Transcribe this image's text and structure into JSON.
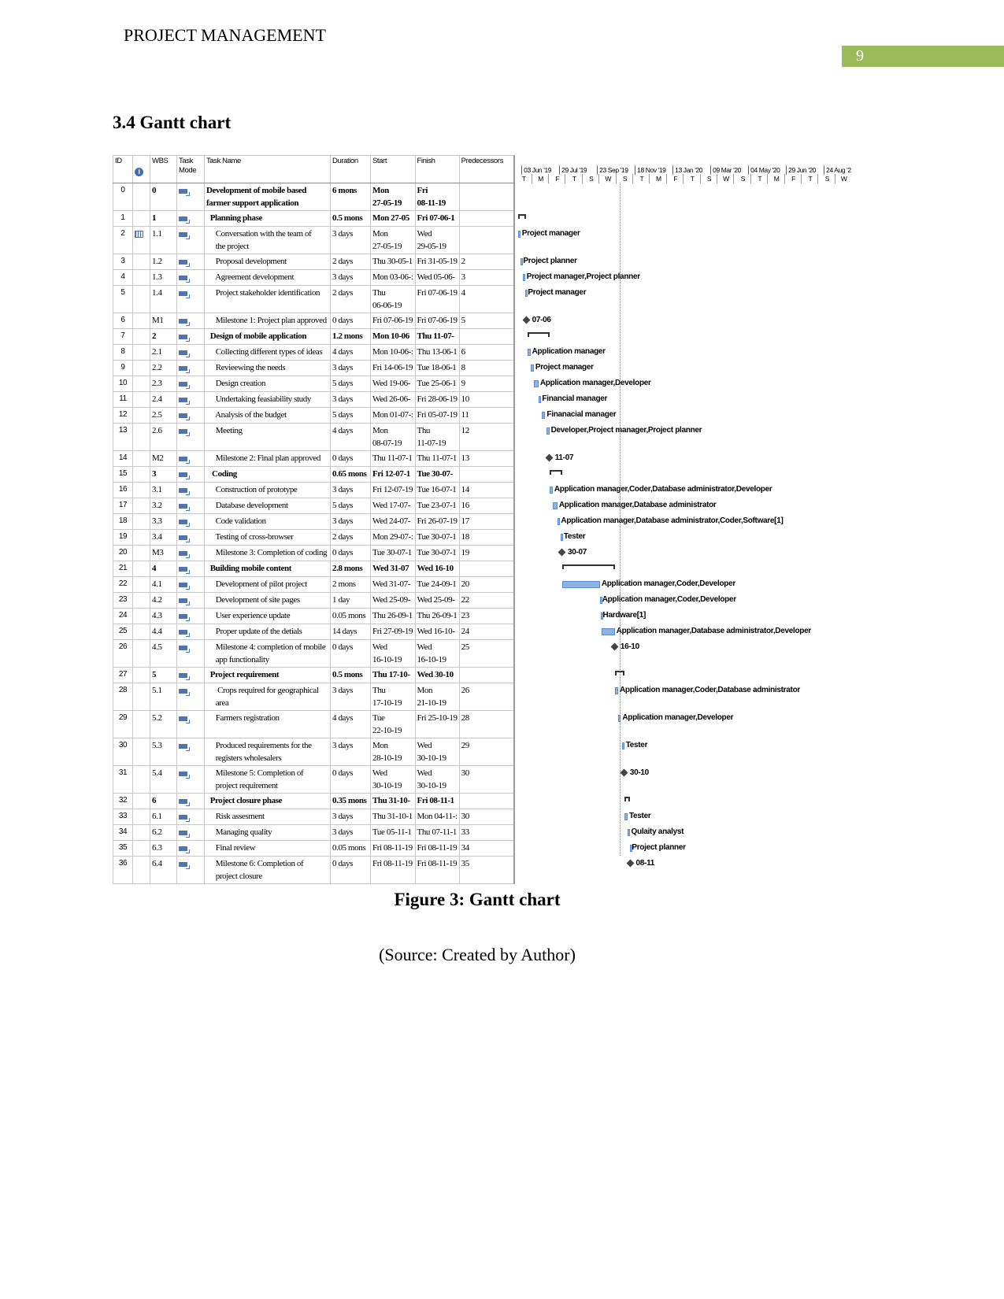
{
  "header": {
    "running_head": "PROJECT MANAGEMENT",
    "page_number": "9",
    "accent": "#9bbb59"
  },
  "section_title": "3.4 Gantt chart",
  "figure": {
    "caption": "Figure 3: Gantt chart",
    "source": "(Source: Created by Author)"
  },
  "chart_data": {
    "type": "gantt",
    "columns": [
      "ID",
      "",
      "WBS",
      "Task\nMode",
      "Task Name",
      "Duration",
      "Start",
      "Finish",
      "Predecessors"
    ],
    "timescale": [
      "03 Jun '19",
      "29 Jul '19",
      "23 Sep '19",
      "18 Nov '19",
      "13 Jan '20",
      "09 Mar '20",
      "04 May '20",
      "29 Jun '20",
      "24 Aug '2"
    ],
    "timescale_days": [
      "T",
      "M",
      "F",
      "T",
      "S",
      "W",
      "S",
      "T",
      "M",
      "F",
      "T",
      "S",
      "W",
      "S",
      "T",
      "M",
      "F",
      "T",
      "S",
      "W"
    ],
    "bar_color": "#8db3e2",
    "tasks": [
      {
        "id": "0",
        "wbs": "0",
        "name": "Development of mobile based\nfarmer support application",
        "duration": "6 mons",
        "start": "Mon\n27-05-19",
        "finish": "Fri\n08-11-19",
        "pred": "",
        "kind": "project",
        "from": "2019-05-27",
        "to": "2019-11-08",
        "resources": ""
      },
      {
        "id": "1",
        "wbs": "1",
        "name": "  Planning phase",
        "duration": "0.5 mons",
        "start": "Mon 27-05",
        "finish": "Fri 07-06-1",
        "pred": "",
        "kind": "summary",
        "from": "2019-05-27",
        "to": "2019-06-07",
        "resources": ""
      },
      {
        "id": "2",
        "wbs": "1.1",
        "name": "     Conversation with the team of\n     the project",
        "duration": "3 days",
        "start": "Mon\n27-05-19",
        "finish": "Wed\n29-05-19",
        "pred": "",
        "kind": "task",
        "from": "2019-05-27",
        "to": "2019-05-29",
        "resources": "Project manager",
        "note": true
      },
      {
        "id": "3",
        "wbs": "1.2",
        "name": "     Proposal development",
        "duration": "2 days",
        "start": "Thu 30-05-1",
        "finish": "Fri 31-05-19",
        "pred": "2",
        "kind": "task",
        "from": "2019-05-30",
        "to": "2019-05-31",
        "resources": "Project planner"
      },
      {
        "id": "4",
        "wbs": "1.3",
        "name": "     Agreement development",
        "duration": "3 days",
        "start": "Mon 03-06-:",
        "finish": "Wed 05-06-",
        "pred": "3",
        "kind": "task",
        "from": "2019-06-03",
        "to": "2019-06-05",
        "resources": "Project manager,Project planner"
      },
      {
        "id": "5",
        "wbs": "1.4",
        "name": "     Project stakeholder identification",
        "duration": "2 days",
        "start": "Thu\n06-06-19",
        "finish": "Fri 07-06-19",
        "pred": "4",
        "kind": "task",
        "from": "2019-06-06",
        "to": "2019-06-07",
        "resources": "Project manager"
      },
      {
        "id": "6",
        "wbs": "M1",
        "name": "     Milestone 1: Project plan approved",
        "duration": "0 days",
        "start": "Fri 07-06-19",
        "finish": "Fri 07-06-19",
        "pred": "5",
        "kind": "milestone",
        "from": "2019-06-07",
        "to": "2019-06-07",
        "resources": "07-06"
      },
      {
        "id": "7",
        "wbs": "2",
        "name": "  Design of mobile application",
        "duration": "1.2 mons",
        "start": "Mon 10-06",
        "finish": "Thu 11-07-",
        "pred": "",
        "kind": "summary",
        "from": "2019-06-10",
        "to": "2019-07-11",
        "resources": ""
      },
      {
        "id": "8",
        "wbs": "2.1",
        "name": "     Collecting different types of ideas",
        "duration": "4 days",
        "start": "Mon 10-06-:",
        "finish": "Thu 13-06-1",
        "pred": "6",
        "kind": "task",
        "from": "2019-06-10",
        "to": "2019-06-13",
        "resources": "Application manager"
      },
      {
        "id": "9",
        "wbs": "2.2",
        "name": "     Revieewing the needs",
        "duration": "3 days",
        "start": "Fri 14-06-19",
        "finish": "Tue 18-06-1",
        "pred": "8",
        "kind": "task",
        "from": "2019-06-14",
        "to": "2019-06-18",
        "resources": "Project manager"
      },
      {
        "id": "10",
        "wbs": "2.3",
        "name": "     Design creation",
        "duration": "5 days",
        "start": "Wed 19-06-",
        "finish": "Tue 25-06-1",
        "pred": "9",
        "kind": "task",
        "from": "2019-06-19",
        "to": "2019-06-25",
        "resources": "Application manager,Developer"
      },
      {
        "id": "11",
        "wbs": "2.4",
        "name": "     Undertaking feasiability study",
        "duration": "3 days",
        "start": "Wed 26-06-",
        "finish": "Fri 28-06-19",
        "pred": "10",
        "kind": "task",
        "from": "2019-06-26",
        "to": "2019-06-28",
        "resources": "Financial manager"
      },
      {
        "id": "12",
        "wbs": "2.5",
        "name": "     Analysis of the budget",
        "duration": "5 days",
        "start": "Mon 01-07-:",
        "finish": "Fri 05-07-19",
        "pred": "11",
        "kind": "task",
        "from": "2019-07-01",
        "to": "2019-07-05",
        "resources": "Finanacial manager"
      },
      {
        "id": "13",
        "wbs": "2.6",
        "name": "     Meeting",
        "duration": "4 days",
        "start": "Mon\n08-07-19",
        "finish": "Thu\n11-07-19",
        "pred": "12",
        "kind": "task",
        "from": "2019-07-08",
        "to": "2019-07-11",
        "resources": "Developer,Project manager,Project planner"
      },
      {
        "id": "14",
        "wbs": "M2",
        "name": "     Milestone 2: Final plan approved",
        "duration": "0 days",
        "start": "Thu 11-07-1",
        "finish": "Thu 11-07-1",
        "pred": "13",
        "kind": "milestone",
        "from": "2019-07-11",
        "to": "2019-07-11",
        "resources": "11-07"
      },
      {
        "id": "15",
        "wbs": "3",
        "name": "   Coding",
        "duration": "0.65 mons",
        "start": "Fri 12-07-1",
        "finish": "Tue 30-07-",
        "pred": "",
        "kind": "summary",
        "from": "2019-07-12",
        "to": "2019-07-30",
        "resources": ""
      },
      {
        "id": "16",
        "wbs": "3.1",
        "name": "     Construction of prototype",
        "duration": "3 days",
        "start": "Fri 12-07-19",
        "finish": "Tue 16-07-1",
        "pred": "14",
        "kind": "task",
        "from": "2019-07-12",
        "to": "2019-07-16",
        "resources": "Application manager,Coder,Database administrator,Developer"
      },
      {
        "id": "17",
        "wbs": "3.2",
        "name": "     Database development",
        "duration": "5 days",
        "start": "Wed 17-07-",
        "finish": "Tue 23-07-1",
        "pred": "16",
        "kind": "task",
        "from": "2019-07-17",
        "to": "2019-07-23",
        "resources": "Application manager,Database administrator"
      },
      {
        "id": "18",
        "wbs": "3.3",
        "name": "     Code validation",
        "duration": "3 days",
        "start": "Wed 24-07-",
        "finish": "Fri 26-07-19",
        "pred": "17",
        "kind": "task",
        "from": "2019-07-24",
        "to": "2019-07-26",
        "resources": "Application manager,Database administrator,Coder,Software[1]"
      },
      {
        "id": "19",
        "wbs": "3.4",
        "name": "     Testing of cross-browser",
        "duration": "2 days",
        "start": "Mon 29-07-:",
        "finish": "Tue 30-07-1",
        "pred": "18",
        "kind": "task",
        "from": "2019-07-29",
        "to": "2019-07-30",
        "resources": "Tester"
      },
      {
        "id": "20",
        "wbs": "M3",
        "name": "     Milestone 3: Completion of coding",
        "duration": "0 days",
        "start": "Tue 30-07-1",
        "finish": "Tue 30-07-1",
        "pred": "19",
        "kind": "milestone",
        "from": "2019-07-30",
        "to": "2019-07-30",
        "resources": "30-07"
      },
      {
        "id": "21",
        "wbs": "4",
        "name": "  Building mobile content",
        "duration": "2.8 mons",
        "start": "Wed 31-07",
        "finish": "Wed 16-10",
        "pred": "",
        "kind": "summary",
        "from": "2019-07-31",
        "to": "2019-10-16",
        "resources": ""
      },
      {
        "id": "22",
        "wbs": "4.1",
        "name": "     Development of pilot project",
        "duration": "2 mons",
        "start": "Wed 31-07-",
        "finish": "Tue 24-09-1",
        "pred": "20",
        "kind": "task",
        "from": "2019-07-31",
        "to": "2019-09-24",
        "resources": "Application manager,Coder,Developer"
      },
      {
        "id": "23",
        "wbs": "4.2",
        "name": "     Development of site pages",
        "duration": "1 day",
        "start": "Wed 25-09-",
        "finish": "Wed 25-09-",
        "pred": "22",
        "kind": "task",
        "from": "2019-09-25",
        "to": "2019-09-25",
        "resources": "Application manager,Coder,Developer"
      },
      {
        "id": "24",
        "wbs": "4.3",
        "name": "     User experience update",
        "duration": "0.05 mons",
        "start": "Thu 26-09-1",
        "finish": "Thu 26-09-1",
        "pred": "23",
        "kind": "task",
        "from": "2019-09-26",
        "to": "2019-09-26",
        "resources": "Hardware[1]"
      },
      {
        "id": "25",
        "wbs": "4.4",
        "name": "     Proper update of the detials",
        "duration": "14 days",
        "start": "Fri 27-09-19",
        "finish": "Wed 16-10-",
        "pred": "24",
        "kind": "task",
        "from": "2019-09-27",
        "to": "2019-10-16",
        "resources": "Application manager,Database administrator,Developer"
      },
      {
        "id": "26",
        "wbs": "4.5",
        "name": "     Milestone 4: completion of mobile\n     app functionality",
        "duration": "0 days",
        "start": "Wed\n16-10-19",
        "finish": "Wed\n16-10-19",
        "pred": "25",
        "kind": "milestone",
        "from": "2019-10-16",
        "to": "2019-10-16",
        "resources": "16-10"
      },
      {
        "id": "27",
        "wbs": "5",
        "name": "  Project requirement",
        "duration": "0.5 mons",
        "start": "Thu 17-10-",
        "finish": "Wed 30-10",
        "pred": "",
        "kind": "summary",
        "from": "2019-10-17",
        "to": "2019-10-30",
        "resources": ""
      },
      {
        "id": "28",
        "wbs": "5.1",
        "name": "      Crops required for geographical\n     area",
        "duration": "3 days",
        "start": "Thu\n17-10-19",
        "finish": "Mon\n21-10-19",
        "pred": "26",
        "kind": "task",
        "from": "2019-10-17",
        "to": "2019-10-21",
        "resources": "Application manager,Coder,Database administrator"
      },
      {
        "id": "29",
        "wbs": "5.2",
        "name": "     Farmers registration",
        "duration": "4 days",
        "start": "Tue\n22-10-19",
        "finish": "Fri 25-10-19",
        "pred": "28",
        "kind": "task",
        "from": "2019-10-22",
        "to": "2019-10-25",
        "resources": "Application manager,Developer"
      },
      {
        "id": "30",
        "wbs": "5.3",
        "name": "     Produced requirements for the\n     registers wholesalers",
        "duration": "3 days",
        "start": "Mon\n28-10-19",
        "finish": "Wed\n30-10-19",
        "pred": "29",
        "kind": "task",
        "from": "2019-10-28",
        "to": "2019-10-30",
        "resources": "Tester"
      },
      {
        "id": "31",
        "wbs": "5.4",
        "name": "     Milestone 5: Completion of\n     project requirement",
        "duration": "0 days",
        "start": "Wed\n30-10-19",
        "finish": "Wed\n30-10-19",
        "pred": "30",
        "kind": "milestone",
        "from": "2019-10-30",
        "to": "2019-10-30",
        "resources": "30-10"
      },
      {
        "id": "32",
        "wbs": "6",
        "name": "  Project closure phase",
        "duration": "0.35 mons",
        "start": "Thu 31-10-",
        "finish": "Fri 08-11-1",
        "pred": "",
        "kind": "summary",
        "from": "2019-10-31",
        "to": "2019-11-08",
        "resources": ""
      },
      {
        "id": "33",
        "wbs": "6.1",
        "name": "     Risk assesment",
        "duration": "3 days",
        "start": "Thu 31-10-1",
        "finish": "Mon 04-11-:",
        "pred": "30",
        "kind": "task",
        "from": "2019-10-31",
        "to": "2019-11-04",
        "resources": "Tester"
      },
      {
        "id": "34",
        "wbs": "6.2",
        "name": "     Managing quality",
        "duration": "3 days",
        "start": "Tue 05-11-1",
        "finish": "Thu 07-11-1",
        "pred": "33",
        "kind": "task",
        "from": "2019-11-05",
        "to": "2019-11-07",
        "resources": "Qulaity analyst"
      },
      {
        "id": "35",
        "wbs": "6.3",
        "name": "     Final review",
        "duration": "0.05 mons",
        "start": "Fri 08-11-19",
        "finish": "Fri 08-11-19",
        "pred": "34",
        "kind": "task",
        "from": "2019-11-08",
        "to": "2019-11-08",
        "resources": "Project planner"
      },
      {
        "id": "36",
        "wbs": "6.4",
        "name": "     Milestone 6: Completion of\n     project closure",
        "duration": "0 days",
        "start": "Fri 08-11-19",
        "finish": "Fri 08-11-19",
        "pred": "35",
        "kind": "milestone",
        "from": "2019-11-08",
        "to": "2019-11-08",
        "resources": "08-11"
      }
    ]
  }
}
